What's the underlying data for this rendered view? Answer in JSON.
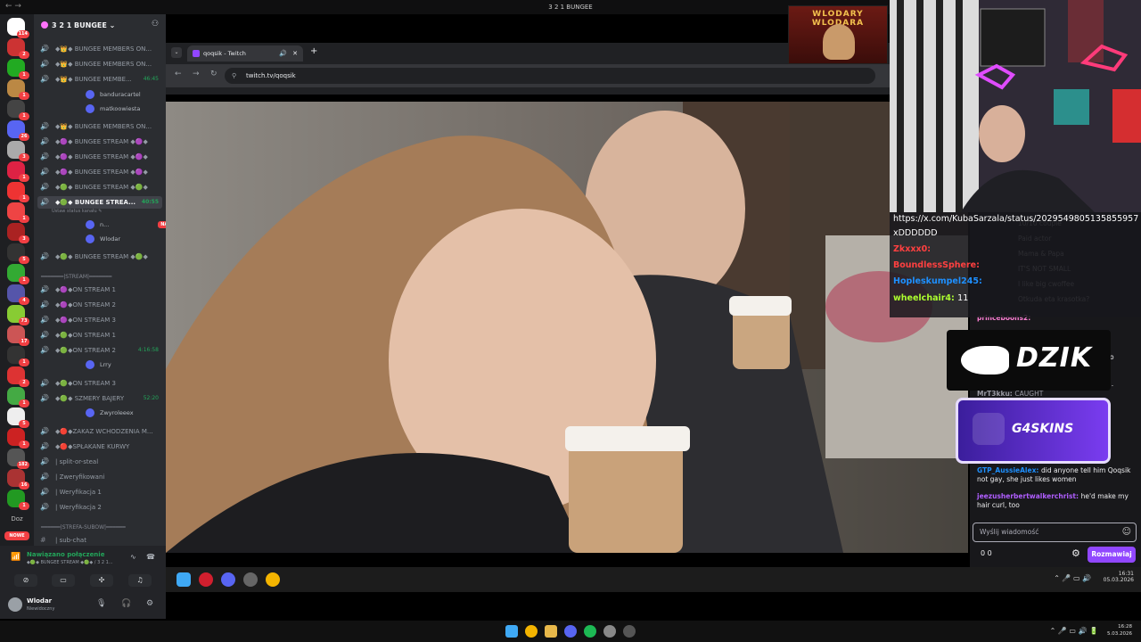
{
  "window": {
    "title": "3 2 1 BUNGEE",
    "back": "← →"
  },
  "discord": {
    "server_name": "3 2 1 BUNGEE",
    "rail": {
      "badges": [
        "114",
        "2",
        "1",
        "1",
        "1",
        "26",
        "3",
        "1",
        "1",
        "1",
        "3",
        "5",
        "1",
        "4",
        "73",
        "17",
        "1",
        "2",
        "1",
        "5",
        "1",
        "182",
        "16",
        "1"
      ],
      "label_doz": "Doz",
      "new_label": "NOWE"
    },
    "channels": [
      {
        "name": "◆👑◆ BUNGEE MEMBERS ON...",
        "time": ""
      },
      {
        "name": "◆👑◆ BUNGEE MEMBERS ON...",
        "time": ""
      },
      {
        "name": "◆👑◆ BUNGEE MEMBE...",
        "time": "46:45"
      },
      {
        "name": "◆👑◆ BUNGEE MEMBERS ON...",
        "time": ""
      },
      {
        "name": "◆🟣◆ BUNGEE STREAM ◆🟣◆",
        "time": ""
      },
      {
        "name": "◆🟣◆ BUNGEE STREAM ◆🟣◆",
        "time": ""
      },
      {
        "name": "◆🟣◆ BUNGEE STREAM ◆🟣◆",
        "time": ""
      },
      {
        "name": "◆🟢◆ BUNGEE STREAM ◆🟢◆",
        "time": ""
      },
      {
        "name": "◆🟢◆ BUNGEE STREA...",
        "time": "40:55"
      },
      {
        "name": "◆🟢◆ BUNGEE STREAM ◆🟢◆",
        "time": ""
      }
    ],
    "users_a": [
      {
        "name": "banduracartel"
      },
      {
        "name": "matkoowiesta"
      }
    ],
    "status_hint": "Ustaw status kanału ✎",
    "users_b": [
      {
        "name": "n...",
        "live": "NA ŻYWO"
      },
      {
        "name": "Wlodar",
        "live": ""
      }
    ],
    "stream_sep": "━━━━━━━|STREAM|━━━━━━━",
    "stream_channels": [
      {
        "name": "◆🟣◆ON STREAM 1",
        "time": ""
      },
      {
        "name": "◆🟣◆ON STREAM 2",
        "time": ""
      },
      {
        "name": "◆🟣◆ON STREAM 3",
        "time": ""
      },
      {
        "name": "◆🟢◆ON STREAM 1",
        "time": ""
      },
      {
        "name": "◆🟢◆ON STREAM 2",
        "time": "4:16:58"
      }
    ],
    "user_lrry": "Lrry",
    "stream_channels_b": [
      {
        "name": "◆🟢◆ON STREAM 3",
        "time": ""
      },
      {
        "name": "◆🟢◆ SZMERY BAJERY",
        "time": "52:20"
      }
    ],
    "user_zwyro": "Zwyroleeex",
    "misc_channels": [
      "◆🔴◆ZAKAZ WCHODZENIA M...",
      "◆🔴◆SPŁAKANE KURWY",
      "| split-or-steal",
      "| Zweryfikowani",
      "| Weryfikacja 1",
      "| Weryfikacja 2"
    ],
    "strefa_sep": "━━━━━━|STREFA-SUBOW|━━━━━━",
    "subchat": "| sub-chat",
    "voice": {
      "status": "Nawiązano połączenie",
      "channel": "◆🟢◆ BUNGEE STREAM ◆🟢◆ / 3 2 1..."
    },
    "user": {
      "name": "Wlodar",
      "status": "Niewidoczny"
    }
  },
  "browser": {
    "tab_title": "qoqsik - Twitch",
    "url": "twitch.tv/qoqsik"
  },
  "overlay_logo": "WLODARY WLODARA",
  "chat_overlay": {
    "url_line": "https://x.com/KubaSarzala/status/2029549805135855957",
    "url_line2": "xDDDDDD",
    "lines": [
      {
        "user": "Zkxxx0:",
        "color": "#ff4040",
        "text": ""
      },
      {
        "user": "BoundlessSphere:",
        "color": "#ff4040",
        "text": ""
      },
      {
        "user": "Hopleskumpel245:",
        "color": "#1e90ff",
        "text": ""
      },
      {
        "user": "wheelchair4:",
        "color": "#adff2f",
        "text": "11"
      }
    ]
  },
  "chat": {
    "bg_lines": [
      "10/10 couple",
      "Paid actor",
      "Mama & Papa",
      "IT'S NOT SMALL",
      "I like big cwoffee",
      "Otkuda eta krasotka?"
    ],
    "princeboons": "princeboons2:",
    "caught_user": "MrT3kku:",
    "caught_text": "CAUGHT",
    "messages": [
      {
        "user": "GTP_AussieAlex:",
        "color": "#1e90ff",
        "text": "did anyone tell him Qoqsik not gay, she just likes women"
      },
      {
        "user": "jeezusherbertwalkerchrist:",
        "color": "#b05eff",
        "text": "he'd make my hair curl, too"
      }
    ],
    "side_fragments": [
      "to",
      "..."
    ],
    "dzik": "DZIK",
    "g4skins": "G4SKINS",
    "input_placeholder": "Wyślij wiadomość",
    "points": "0   0",
    "send_label": "Rozmawiaj"
  },
  "inner_clock": {
    "time": "16:31",
    "date": "05.03.2026"
  },
  "host_clock": {
    "time": "16:28",
    "date": "5.03.2026"
  }
}
